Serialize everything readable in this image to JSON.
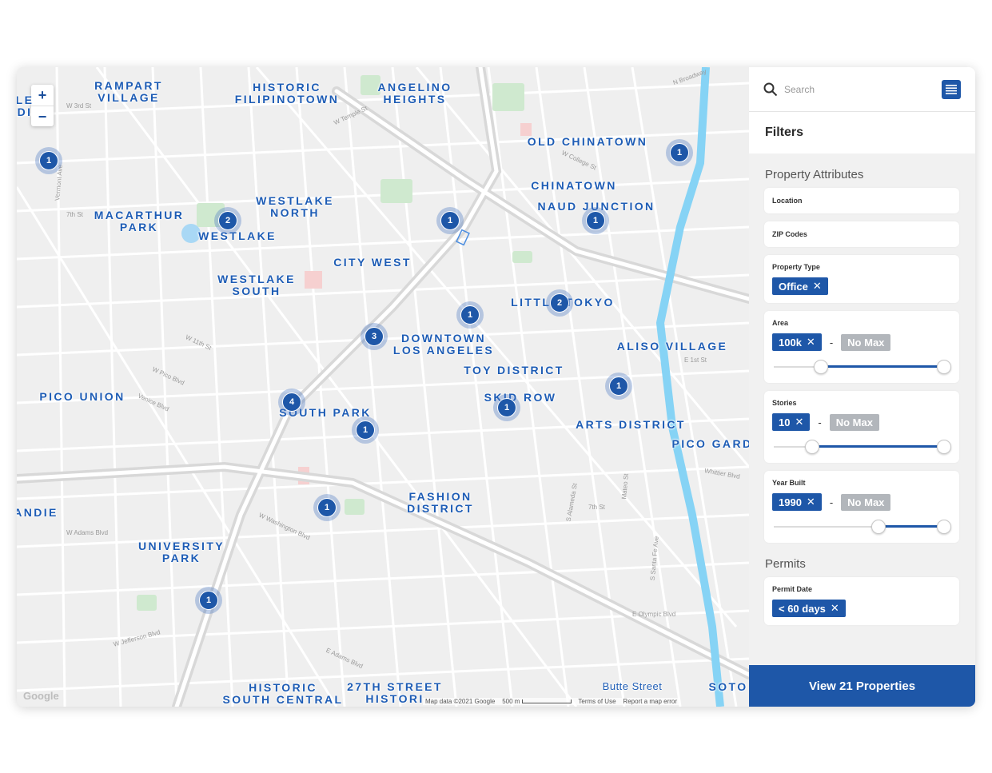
{
  "map": {
    "zoom_in": "+",
    "zoom_out": "−",
    "google_logo": "Google",
    "footer": {
      "map_data": "Map data ©2021 Google",
      "scale": "500 m",
      "terms": "Terms of Use",
      "report": "Report a map error"
    },
    "neighborhoods": [
      "RAMPART\nVILLAGE",
      "HISTORIC\nFILIPINOTOWN",
      "ANGELINO\nHEIGHTS",
      "OLD CHINATOWN",
      "CHINATOWN",
      "NAUD JUNCTION",
      "WESTLAKE\nNORTH",
      "MACARTHUR\nPARK",
      "WESTLAKE",
      "CITY WEST",
      "WESTLAKE\nSOUTH",
      "LITTLE TOKYO",
      "DOWNTOWN\nLOS ANGELES",
      "ALISO VILLAGE",
      "TOY DISTRICT",
      "PICO UNION",
      "SKID ROW",
      "SOUTH PARK",
      "ARTS DISTRICT",
      "PICO GARD",
      "FASHION\nDISTRICT",
      "ANDIE",
      "UNIVERSITY\nPARK",
      "HISTORIC\nSOUTH CENTRAL",
      "27TH STREET\nHISTORI",
      "SOTO",
      "LE\nDI"
    ],
    "places": [
      "Butte Street"
    ],
    "streets": [
      "W 3rd St",
      "W Temple St",
      "N Broadway",
      "W College St",
      "7th St",
      "W 11th St",
      "W Pico Blvd",
      "Venice Blvd",
      "E 1st St",
      "Whittier Blvd",
      "7th St",
      "E Olympic Blvd",
      "W Adams Blvd",
      "W Jefferson Blvd",
      "W Washington Blvd",
      "E Adams Blvd",
      "S Alameda St",
      "Mateo St",
      "S Santa Fe Ave",
      "Vermont Ave"
    ],
    "clusters": [
      "1",
      "1",
      "1",
      "2",
      "1",
      "2",
      "1",
      "3",
      "4",
      "1",
      "1",
      "1",
      "1",
      "1"
    ]
  },
  "panel": {
    "search_placeholder": "Search",
    "filters_title": "Filters",
    "property_attributes_title": "Property Attributes",
    "location_label": "Location",
    "zip_label": "ZIP Codes",
    "property_type": {
      "label": "Property Type",
      "chip": "Office"
    },
    "area": {
      "label": "Area",
      "min": "100k",
      "max": "No Max",
      "range_low": 0.25,
      "range_high": 1.0
    },
    "stories": {
      "label": "Stories",
      "min": "10",
      "max": "No Max",
      "range_low": 0.2,
      "range_high": 1.0
    },
    "year_built": {
      "label": "Year Built",
      "min": "1990",
      "max": "No Max",
      "range_low": 0.6,
      "range_high": 1.0
    },
    "permits_title": "Permits",
    "permit_date": {
      "label": "Permit Date",
      "chip": "< 60 days"
    },
    "cta": "View 21 Properties"
  },
  "colors": {
    "brand": "#1e57a8",
    "label": "#1d5cb5",
    "river": "#7fd0f4",
    "park": "#c8e6c9"
  }
}
